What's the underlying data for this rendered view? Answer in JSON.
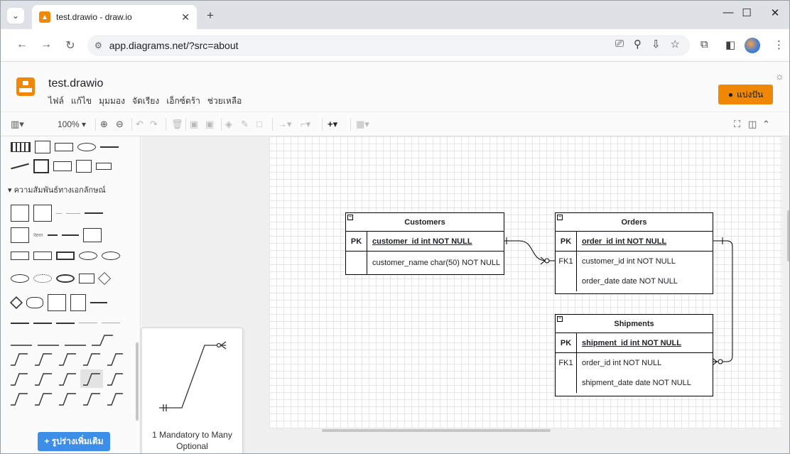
{
  "browser": {
    "tab_title": "test.drawio - draw.io",
    "favicon_letter": "▲",
    "url": "app.diagrams.net/?src=about"
  },
  "app": {
    "doc_title": "test.drawio",
    "menus": [
      "ไฟล์",
      "แก้ไข",
      "มุมมอง",
      "จัดเรียง",
      "เอ็กซ์ตร้า",
      "ช่วยเหลือ"
    ],
    "share_label": "แบ่งปัน"
  },
  "toolbar": {
    "zoom": "100%"
  },
  "sidebar": {
    "section_title": "ความสัมพันธ์ทางเอกลักษณ์",
    "more_shapes_label": "+ รูปร่างเพิ่มเติม",
    "preview_label": "1 Mandatory to Many Optional",
    "shape_item_label": "Item"
  },
  "diagram": {
    "tables": [
      {
        "name": "Customers",
        "rows": [
          {
            "key": "PK",
            "field": "customer_id int NOT NULL",
            "pk": true
          },
          {
            "key": "",
            "field": "customer_name char(50) NOT NULL",
            "pk": false
          }
        ]
      },
      {
        "name": "Orders",
        "rows": [
          {
            "key": "PK",
            "field": "order_id int NOT NULL",
            "pk": true
          },
          {
            "key": "FK1",
            "field": "customer_id int NOT NULL",
            "pk": false
          },
          {
            "key": "",
            "field": "order_date date NOT NULL",
            "pk": false
          }
        ]
      },
      {
        "name": "Shipments",
        "rows": [
          {
            "key": "PK",
            "field": "shipment_id int NOT NULL",
            "pk": true
          },
          {
            "key": "FK1",
            "field": "order_id int NOT NULL",
            "pk": false
          },
          {
            "key": "",
            "field": "shipment_date date NOT NULL",
            "pk": false
          }
        ]
      }
    ]
  },
  "colors": {
    "accent": "#f08705",
    "more_shapes": "#3d8ee8"
  }
}
